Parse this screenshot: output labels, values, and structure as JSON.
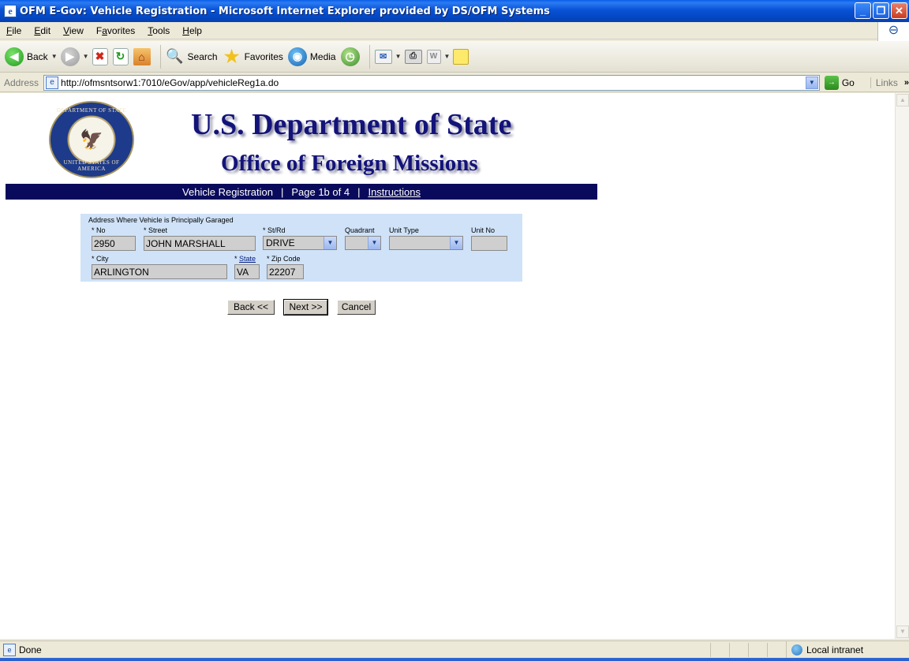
{
  "window": {
    "title": "OFM E-Gov: Vehicle Registration - Microsoft Internet Explorer provided by DS/OFM Systems",
    "app_icon": "ie-icon",
    "controls": [
      "minimize-icon",
      "restore-icon",
      "close-icon"
    ]
  },
  "menu": {
    "items": [
      {
        "label": "File",
        "key": "F",
        "rest": "ile"
      },
      {
        "label": "Edit",
        "key": "E",
        "rest": "dit"
      },
      {
        "label": "View",
        "key": "V",
        "rest": "iew"
      },
      {
        "label": "Favorites",
        "key": "a",
        "pre": "F",
        "rest": "vorites"
      },
      {
        "label": "Tools",
        "key": "T",
        "rest": "ools"
      },
      {
        "label": "Help",
        "key": "H",
        "rest": "elp"
      }
    ]
  },
  "toolbar": {
    "back_label": "Back",
    "search_label": "Search",
    "favorites_label": "Favorites",
    "media_label": "Media"
  },
  "address": {
    "label": "Address",
    "url": "http://ofmsntsorw1:7010/eGov/app/vehicleReg1a.do",
    "go_label": "Go",
    "links_label": "Links"
  },
  "page": {
    "seal_top_text": "DEPARTMENT OF STATE",
    "seal_bottom_text": "UNITED STATES OF AMERICA",
    "department_title": "U.S. Department of State",
    "office_title": "Office of Foreign Missions",
    "nav": {
      "section": "Vehicle Registration",
      "separator": "|",
      "page_info": "Page 1b of 4",
      "instructions_link": "Instructions"
    },
    "form": {
      "section_label": "Address Where Vehicle is Principally Garaged",
      "no_label": "* No",
      "no_value": "2950",
      "street_label": "* Street",
      "street_value": "JOHN MARSHALL",
      "strd_label": "* St/Rd",
      "strd_value": "DRIVE",
      "quadrant_label": "Quadrant",
      "quadrant_value": "",
      "unit_type_label": "Unit Type",
      "unit_type_value": "",
      "unit_no_label": "Unit No",
      "unit_no_value": "",
      "city_label": "* City",
      "city_value": "ARLINGTON",
      "state_prefix": "* ",
      "state_label": "State",
      "state_value": "VA",
      "zip_label": "* Zip Code",
      "zip_value": "22207"
    },
    "buttons": {
      "back": "Back <<",
      "next": "Next >>",
      "cancel": "Cancel"
    }
  },
  "status": {
    "text": "Done",
    "zone": "Local intranet"
  }
}
